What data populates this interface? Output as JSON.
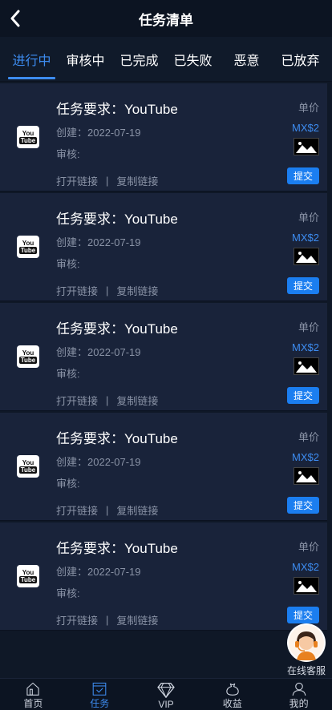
{
  "header": {
    "title": "任务清单"
  },
  "tabs": [
    {
      "label": "进行中",
      "active": true
    },
    {
      "label": "审核中",
      "active": false
    },
    {
      "label": "已完成",
      "active": false
    },
    {
      "label": "已失败",
      "active": false
    },
    {
      "label": "恶意",
      "active": false
    },
    {
      "label": "已放弃",
      "active": false
    }
  ],
  "tasks": [
    {
      "title": "任务要求：YouTube",
      "created": "创建：2022-07-19",
      "review": "审核:",
      "open_link": "打开链接",
      "copy_link": "复制链接",
      "price_label": "单价",
      "price": "MX$2",
      "submit": "提交",
      "icon": "youtube-icon"
    },
    {
      "title": "任务要求：YouTube",
      "created": "创建：2022-07-19",
      "review": "审核:",
      "open_link": "打开链接",
      "copy_link": "复制链接",
      "price_label": "单价",
      "price": "MX$2",
      "submit": "提交",
      "icon": "youtube-icon"
    },
    {
      "title": "任务要求：YouTube",
      "created": "创建：2022-07-19",
      "review": "审核:",
      "open_link": "打开链接",
      "copy_link": "复制链接",
      "price_label": "单价",
      "price": "MX$2",
      "submit": "提交",
      "icon": "youtube-icon"
    },
    {
      "title": "任务要求：YouTube",
      "created": "创建：2022-07-19",
      "review": "审核:",
      "open_link": "打开链接",
      "copy_link": "复制链接",
      "price_label": "单价",
      "price": "MX$2",
      "submit": "提交",
      "icon": "youtube-icon"
    },
    {
      "title": "任务要求：YouTube",
      "created": "创建：2022-07-19",
      "review": "审核:",
      "open_link": "打开链接",
      "copy_link": "复制链接",
      "price_label": "单价",
      "price": "MX$2",
      "submit": "提交",
      "icon": "youtube-icon"
    }
  ],
  "link_separator": "|",
  "customer_service": {
    "label": "在线客服",
    "icon": "customer-service-avatar"
  },
  "bottom_nav": [
    {
      "label": "首页",
      "icon": "home-icon",
      "active": false
    },
    {
      "label": "任务",
      "icon": "task-icon",
      "active": true
    },
    {
      "label": "VIP",
      "icon": "diamond-icon",
      "active": false
    },
    {
      "label": "收益",
      "icon": "money-bag-icon",
      "active": false
    },
    {
      "label": "我的",
      "icon": "user-icon",
      "active": false
    }
  ],
  "colors": {
    "accent": "#3d8cf0",
    "background": "#0f1827",
    "card": "#19233a",
    "submit": "#1b7ef0"
  }
}
